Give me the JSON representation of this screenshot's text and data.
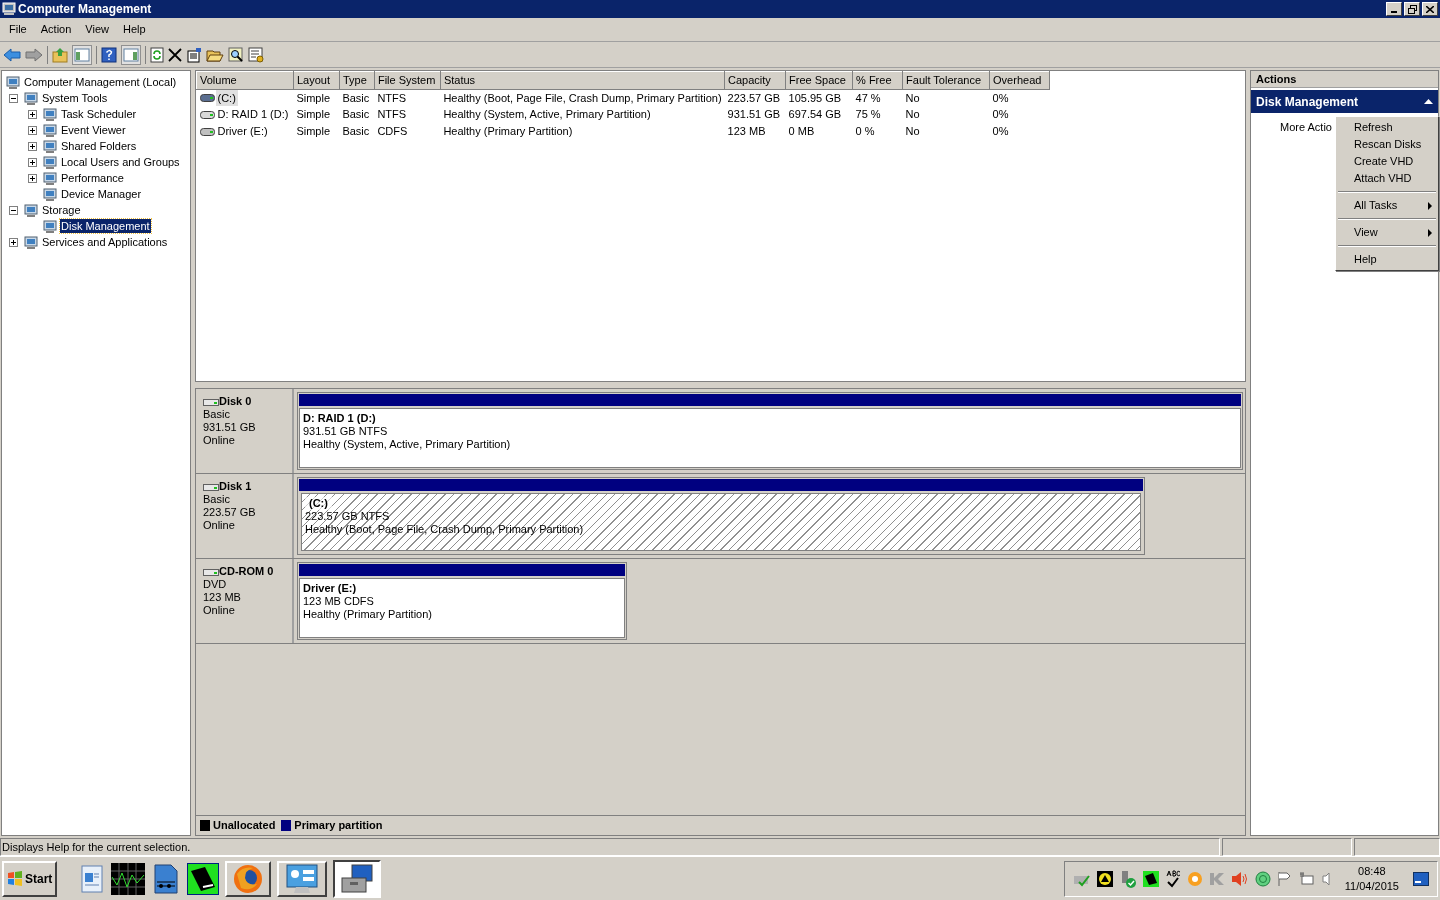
{
  "window": {
    "title": "Computer Management"
  },
  "menu": [
    "File",
    "Action",
    "View",
    "Help"
  ],
  "tree": [
    {
      "label": "Computer Management (Local)",
      "selected": false,
      "children": [
        {
          "label": "System Tools",
          "expanded": true,
          "selected": false,
          "children": [
            {
              "label": "Task Scheduler",
              "expanded": false,
              "selected": false
            },
            {
              "label": "Event Viewer",
              "expanded": false,
              "selected": false
            },
            {
              "label": "Shared Folders",
              "expanded": false,
              "selected": false
            },
            {
              "label": "Local Users and Groups",
              "expanded": false,
              "selected": false
            },
            {
              "label": "Performance",
              "expanded": false,
              "selected": false
            },
            {
              "label": "Device Manager",
              "selected": false
            }
          ]
        },
        {
          "label": "Storage",
          "expanded": true,
          "selected": false,
          "children": [
            {
              "label": "Disk Management",
              "selected": true
            }
          ]
        },
        {
          "label": "Services and Applications",
          "expanded": false,
          "selected": false
        }
      ]
    }
  ],
  "volume_table": {
    "columns": [
      "Volume",
      "Layout",
      "Type",
      "File System",
      "Status",
      "Capacity",
      "Free Space",
      "% Free",
      "Fault Tolerance",
      "Overhead"
    ],
    "rows": [
      {
        "selected": true,
        "cells": [
          "(C:)",
          "Simple",
          "Basic",
          "NTFS",
          "Healthy (Boot, Page File, Crash Dump, Primary Partition)",
          "223.57 GB",
          "105.95 GB",
          "47 %",
          "No",
          "0%"
        ]
      },
      {
        "selected": false,
        "cells": [
          "D: RAID 1 (D:)",
          "Simple",
          "Basic",
          "NTFS",
          "Healthy (System, Active, Primary Partition)",
          "931.51 GB",
          "697.54 GB",
          "75 %",
          "No",
          "0%"
        ]
      },
      {
        "selected": false,
        "cells": [
          "Driver (E:)",
          "Simple",
          "Basic",
          "CDFS",
          "Healthy (Primary Partition)",
          "123 MB",
          "0 MB",
          "0 %",
          "No",
          "0%"
        ]
      }
    ]
  },
  "disks": [
    {
      "name": "Disk 0",
      "type": "Basic",
      "size": "931.51 GB",
      "status": "Online",
      "partition": {
        "title": "D: RAID 1  (D:)",
        "size": "931.51 GB NTFS",
        "status": "Healthy (System, Active, Primary Partition)",
        "selected": false
      }
    },
    {
      "name": "Disk 1",
      "type": "Basic",
      "size": "223.57 GB",
      "status": "Online",
      "partition": {
        "title": "(C:)",
        "size": "223.57 GB NTFS",
        "status": "Healthy (Boot, Page File, Crash Dump, Primary Partition)",
        "selected": true
      }
    },
    {
      "name": "CD-ROM 0",
      "type": "DVD",
      "size": "123 MB",
      "status": "Online",
      "partition": {
        "title": "Driver  (E:)",
        "size": "123 MB CDFS",
        "status": "Healthy (Primary Partition)",
        "selected": false
      }
    }
  ],
  "legend": [
    {
      "label": "Unallocated",
      "color": "#000000"
    },
    {
      "label": "Primary partition",
      "color": "#000080"
    }
  ],
  "actions": {
    "title": "Actions",
    "section": "Disk Management",
    "expanded": true,
    "item": "More Actio"
  },
  "context_menu": [
    [
      {
        "label": "Refresh",
        "submenu": false
      },
      {
        "label": "Rescan Disks",
        "submenu": false
      },
      {
        "label": "Create VHD",
        "submenu": false
      },
      {
        "label": "Attach VHD",
        "submenu": false
      }
    ],
    [
      {
        "label": "All Tasks",
        "submenu": true
      }
    ],
    [
      {
        "label": "View",
        "submenu": true
      }
    ],
    [
      {
        "label": "Help",
        "submenu": false
      }
    ]
  ],
  "status_bar": "Displays Help for the current selection.",
  "taskbar": {
    "start": "Start",
    "time": "08:48",
    "date": "11/04/2015"
  }
}
